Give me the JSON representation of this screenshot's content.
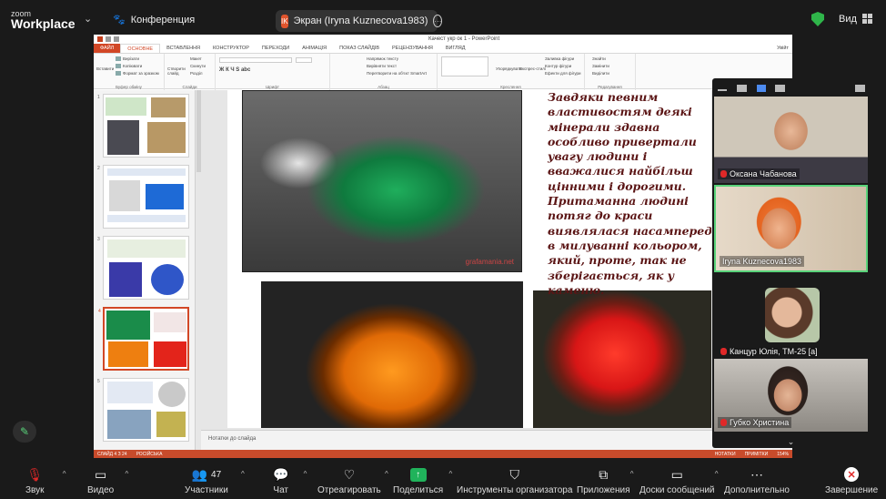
{
  "app": {
    "logo_top": "zoom",
    "logo_bottom": "Workplace",
    "meeting_label": "Конференция"
  },
  "share_pill": {
    "initials": "IK",
    "text": "Экран (Iryna Kuznecova1983)"
  },
  "view_label": "Вид",
  "ppt": {
    "window_title": "Качест укр ок 1 - PowerPoint",
    "tabs": [
      "ФАЙЛ",
      "ОСНОВНЕ",
      "ВСТАВЛЕННЯ",
      "КОНСТРУКТОР",
      "ПЕРЕХОДИ",
      "АНІМАЦІЯ",
      "ПОКАЗ СЛАЙДІВ",
      "РЕЦЕНЗУВАННЯ",
      "ВИГЛЯД"
    ],
    "user": "Увійт",
    "ribbon": {
      "clipboard": {
        "paste": "Вставити",
        "cut": "Вирізати",
        "copy": "Копіювати",
        "format": "Формат за зразком",
        "group": "Буфер обміну"
      },
      "slides": {
        "new": "Створити слайд",
        "layout": "Макет",
        "reset": "Скинути",
        "section": "Розділ",
        "group": "Слайди"
      },
      "font": {
        "group": "Шрифт"
      },
      "paragraph": {
        "dir": "Напрямок тексту",
        "align": "Вирівняти текст",
        "smartart": "Перетворити на об'єкт SmartArt",
        "group": "Абзац"
      },
      "drawing": {
        "arrange": "Упорядкувати",
        "styles": "Експрес-стилі",
        "fill": "Заливка фігури",
        "outline": "Контур фігури",
        "effects": "Ефекти для фігури",
        "group": "Креслення"
      },
      "editing": {
        "find": "Знайти",
        "replace": "Замінити",
        "select": "Виділити",
        "group": "Редагування"
      }
    },
    "slide_text": "Завдяки певним властивостям деякі мінерали здавна особливо привертали увагу людини і вважалися найбільш цінними і дорогими. Притаманна людині потяг до краси виявлялася насамперед в милуванні кольором, який, проте, так не зберігається, як у каменю.",
    "watermark": "grafamania.net",
    "thumb_numbers": [
      "1",
      "2",
      "3",
      "4",
      "5"
    ],
    "notes_placeholder": "Нотатки до слайда",
    "status": {
      "slide": "СЛАЙД 4 З 24",
      "lang": "РОСІЙСЬКА",
      "notes": "НОТАТКИ",
      "comments": "ПРИМІТКИ",
      "zoom": "154%"
    }
  },
  "participants": [
    {
      "name": "Оксана Чабанова",
      "muted": true
    },
    {
      "name": "Iryna Kuznecova1983",
      "muted": false
    },
    {
      "name": "Канцур Юлія, ТМ-25 [а]",
      "muted": true
    },
    {
      "name": "Губко Христина",
      "muted": true
    }
  ],
  "toolbar": {
    "audio": "Звук",
    "video": "Видео",
    "participants": "Участники",
    "participants_count": "47",
    "chat": "Чат",
    "react": "Отреагировать",
    "share": "Поделиться",
    "host_tools": "Инструменты организатора",
    "apps": "Приложения",
    "whiteboards": "Доски сообщений",
    "more": "Дополнительно",
    "end": "Завершение"
  },
  "colors": {
    "accent_green": "#20b35b",
    "ppt_orange": "#d24726",
    "end_red": "#e02828"
  }
}
